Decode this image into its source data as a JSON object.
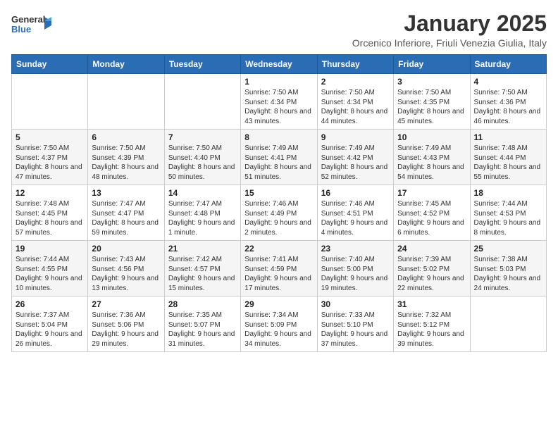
{
  "header": {
    "logo_general": "General",
    "logo_blue": "Blue",
    "month_title": "January 2025",
    "location": "Orcenico Inferiore, Friuli Venezia Giulia, Italy"
  },
  "weekdays": [
    "Sunday",
    "Monday",
    "Tuesday",
    "Wednesday",
    "Thursday",
    "Friday",
    "Saturday"
  ],
  "weeks": [
    [
      {
        "day": "",
        "info": ""
      },
      {
        "day": "",
        "info": ""
      },
      {
        "day": "",
        "info": ""
      },
      {
        "day": "1",
        "info": "Sunrise: 7:50 AM\nSunset: 4:34 PM\nDaylight: 8 hours and 43 minutes."
      },
      {
        "day": "2",
        "info": "Sunrise: 7:50 AM\nSunset: 4:34 PM\nDaylight: 8 hours and 44 minutes."
      },
      {
        "day": "3",
        "info": "Sunrise: 7:50 AM\nSunset: 4:35 PM\nDaylight: 8 hours and 45 minutes."
      },
      {
        "day": "4",
        "info": "Sunrise: 7:50 AM\nSunset: 4:36 PM\nDaylight: 8 hours and 46 minutes."
      }
    ],
    [
      {
        "day": "5",
        "info": "Sunrise: 7:50 AM\nSunset: 4:37 PM\nDaylight: 8 hours and 47 minutes."
      },
      {
        "day": "6",
        "info": "Sunrise: 7:50 AM\nSunset: 4:39 PM\nDaylight: 8 hours and 48 minutes."
      },
      {
        "day": "7",
        "info": "Sunrise: 7:50 AM\nSunset: 4:40 PM\nDaylight: 8 hours and 50 minutes."
      },
      {
        "day": "8",
        "info": "Sunrise: 7:49 AM\nSunset: 4:41 PM\nDaylight: 8 hours and 51 minutes."
      },
      {
        "day": "9",
        "info": "Sunrise: 7:49 AM\nSunset: 4:42 PM\nDaylight: 8 hours and 52 minutes."
      },
      {
        "day": "10",
        "info": "Sunrise: 7:49 AM\nSunset: 4:43 PM\nDaylight: 8 hours and 54 minutes."
      },
      {
        "day": "11",
        "info": "Sunrise: 7:48 AM\nSunset: 4:44 PM\nDaylight: 8 hours and 55 minutes."
      }
    ],
    [
      {
        "day": "12",
        "info": "Sunrise: 7:48 AM\nSunset: 4:45 PM\nDaylight: 8 hours and 57 minutes."
      },
      {
        "day": "13",
        "info": "Sunrise: 7:47 AM\nSunset: 4:47 PM\nDaylight: 8 hours and 59 minutes."
      },
      {
        "day": "14",
        "info": "Sunrise: 7:47 AM\nSunset: 4:48 PM\nDaylight: 9 hours and 1 minute."
      },
      {
        "day": "15",
        "info": "Sunrise: 7:46 AM\nSunset: 4:49 PM\nDaylight: 9 hours and 2 minutes."
      },
      {
        "day": "16",
        "info": "Sunrise: 7:46 AM\nSunset: 4:51 PM\nDaylight: 9 hours and 4 minutes."
      },
      {
        "day": "17",
        "info": "Sunrise: 7:45 AM\nSunset: 4:52 PM\nDaylight: 9 hours and 6 minutes."
      },
      {
        "day": "18",
        "info": "Sunrise: 7:44 AM\nSunset: 4:53 PM\nDaylight: 9 hours and 8 minutes."
      }
    ],
    [
      {
        "day": "19",
        "info": "Sunrise: 7:44 AM\nSunset: 4:55 PM\nDaylight: 9 hours and 10 minutes."
      },
      {
        "day": "20",
        "info": "Sunrise: 7:43 AM\nSunset: 4:56 PM\nDaylight: 9 hours and 13 minutes."
      },
      {
        "day": "21",
        "info": "Sunrise: 7:42 AM\nSunset: 4:57 PM\nDaylight: 9 hours and 15 minutes."
      },
      {
        "day": "22",
        "info": "Sunrise: 7:41 AM\nSunset: 4:59 PM\nDaylight: 9 hours and 17 minutes."
      },
      {
        "day": "23",
        "info": "Sunrise: 7:40 AM\nSunset: 5:00 PM\nDaylight: 9 hours and 19 minutes."
      },
      {
        "day": "24",
        "info": "Sunrise: 7:39 AM\nSunset: 5:02 PM\nDaylight: 9 hours and 22 minutes."
      },
      {
        "day": "25",
        "info": "Sunrise: 7:38 AM\nSunset: 5:03 PM\nDaylight: 9 hours and 24 minutes."
      }
    ],
    [
      {
        "day": "26",
        "info": "Sunrise: 7:37 AM\nSunset: 5:04 PM\nDaylight: 9 hours and 26 minutes."
      },
      {
        "day": "27",
        "info": "Sunrise: 7:36 AM\nSunset: 5:06 PM\nDaylight: 9 hours and 29 minutes."
      },
      {
        "day": "28",
        "info": "Sunrise: 7:35 AM\nSunset: 5:07 PM\nDaylight: 9 hours and 31 minutes."
      },
      {
        "day": "29",
        "info": "Sunrise: 7:34 AM\nSunset: 5:09 PM\nDaylight: 9 hours and 34 minutes."
      },
      {
        "day": "30",
        "info": "Sunrise: 7:33 AM\nSunset: 5:10 PM\nDaylight: 9 hours and 37 minutes."
      },
      {
        "day": "31",
        "info": "Sunrise: 7:32 AM\nSunset: 5:12 PM\nDaylight: 9 hours and 39 minutes."
      },
      {
        "day": "",
        "info": ""
      }
    ]
  ]
}
